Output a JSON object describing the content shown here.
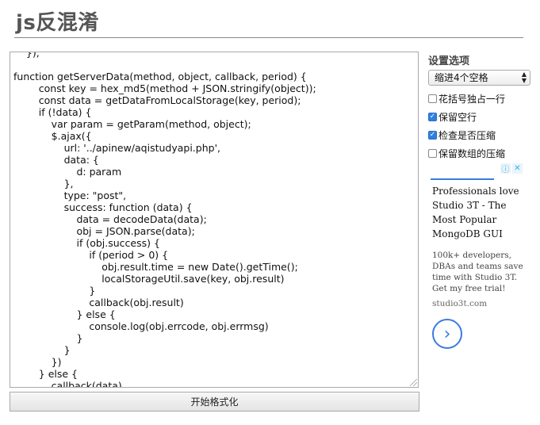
{
  "page": {
    "title": "js反混淆"
  },
  "editor": {
    "code": "    });\n\nfunction getServerData(method, object, callback, period) {\n        const key = hex_md5(method + JSON.stringify(object));\n        const data = getDataFromLocalStorage(key, period);\n        if (!data) {\n            var param = getParam(method, object);\n            $.ajax({\n                url: '../apinew/aqistudyapi.php',\n                data: {\n                    d: param\n                },\n                type: \"post\",\n                success: function (data) {\n                    data = decodeData(data);\n                    obj = JSON.parse(data);\n                    if (obj.success) {\n                        if (period > 0) {\n                            obj.result.time = new Date().getTime();\n                            localStorageUtil.save(key, obj.result)\n                        }\n                        callback(obj.result)\n                    } else {\n                        console.log(obj.errcode, obj.errmsg)\n                    }\n                }\n            })\n        } else {\n            callback(data)"
  },
  "format_button": {
    "label": "开始格式化"
  },
  "settings": {
    "title": "设置选项",
    "indent_select": {
      "value": "缩进4个空格"
    },
    "options": [
      {
        "label": "花括号独占一行",
        "checked": false
      },
      {
        "label": "保留空行",
        "checked": true
      },
      {
        "label": "检查是否压缩",
        "checked": true
      },
      {
        "label": "保留数组的压缩",
        "checked": false
      }
    ]
  },
  "ad": {
    "headline": "Professionals love Studio 3T - The Most Popular MongoDB GUI",
    "body": "100k+ developers, DBAs and teams save time with Studio 3T. Get my free trial!",
    "domain": "studio3t.com",
    "icons": [
      "info-icon",
      "close-icon"
    ],
    "accent_color": "#3b7be0"
  }
}
